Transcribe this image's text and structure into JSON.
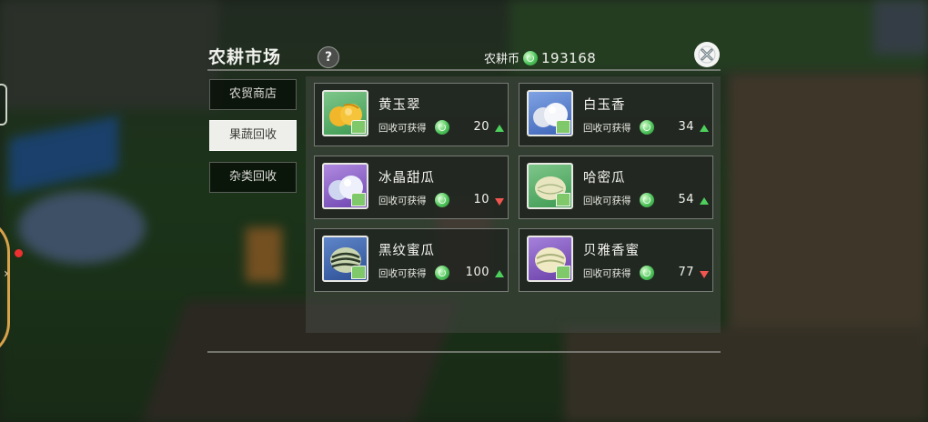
{
  "header": {
    "title": "农耕市场",
    "help_label": "?",
    "currency_label": "农耕币",
    "currency_amount": "193168"
  },
  "tabs": [
    {
      "label": "农贸商店",
      "active": false
    },
    {
      "label": "果蔬回收",
      "active": true
    },
    {
      "label": "杂类回收",
      "active": false
    }
  ],
  "items": [
    {
      "name": "黄玉翠",
      "reward_label": "回收可获得",
      "value": "20",
      "trend": "up",
      "thumb": "green",
      "fruit": "yellow-melon"
    },
    {
      "name": "白玉香",
      "reward_label": "回收可获得",
      "value": "34",
      "trend": "up",
      "thumb": "blue",
      "fruit": "white-melon"
    },
    {
      "name": "冰晶甜瓜",
      "reward_label": "回收可获得",
      "value": "10",
      "trend": "down",
      "thumb": "purple",
      "fruit": "ice-melon"
    },
    {
      "name": "哈密瓜",
      "reward_label": "回收可获得",
      "value": "54",
      "trend": "up",
      "thumb": "green",
      "fruit": "hami-melon"
    },
    {
      "name": "黑纹蜜瓜",
      "reward_label": "回收可获得",
      "value": "100",
      "trend": "up",
      "thumb": "navy",
      "fruit": "striped-melon"
    },
    {
      "name": "贝雅香蜜",
      "reward_label": "回收可获得",
      "value": "77",
      "trend": "down",
      "thumb": "violet",
      "fruit": "cream-melon"
    }
  ],
  "colors": {
    "trend_up": "#4ed05c",
    "trend_down": "#f0564f",
    "coin": "#4ec45a"
  }
}
